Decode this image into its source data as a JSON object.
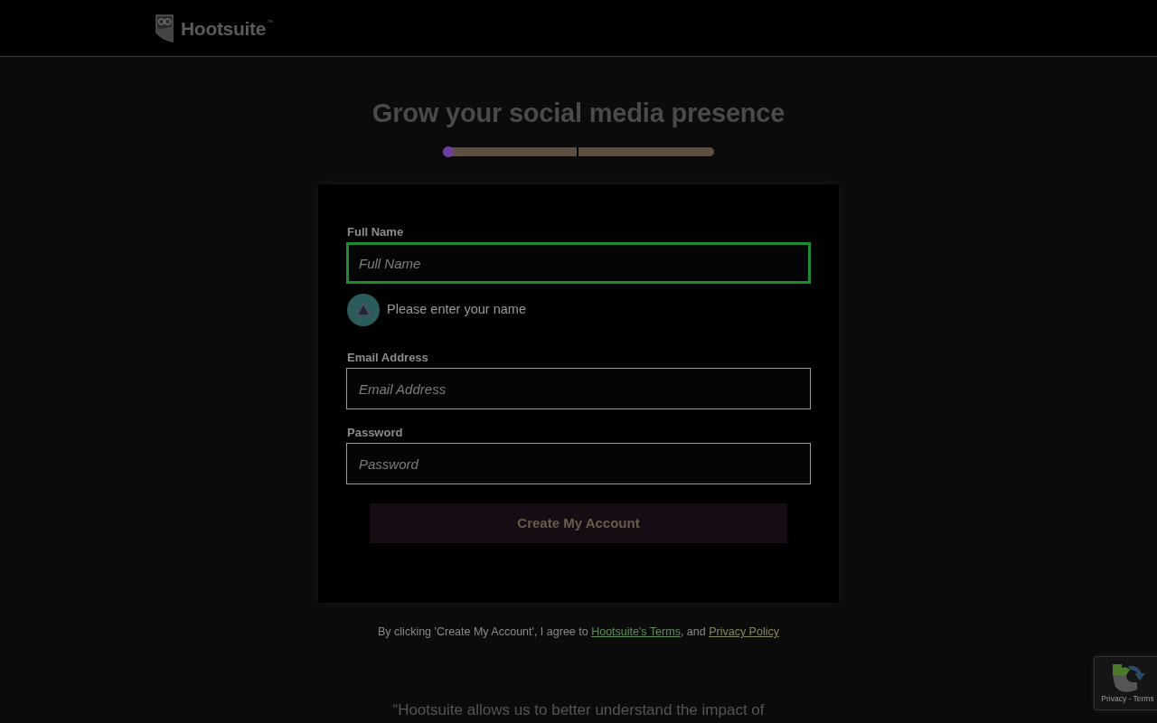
{
  "header": {
    "logo": {
      "wordmark": "Hootsuite",
      "trademark": "™"
    }
  },
  "title": "Grow your social media presence",
  "progress": {
    "level": 0
  },
  "form": {
    "fields": [
      {
        "label": "Full Name",
        "placeholder": "Full Name",
        "focused": true,
        "error": "Please enter your name"
      },
      {
        "label": "Email Address",
        "placeholder": "Email Address",
        "focused": false
      },
      {
        "label": "Password",
        "placeholder": "Password",
        "focused": false
      }
    ],
    "submit_button": "Create My Account"
  },
  "legal": {
    "text": "By clicking 'Create My Account', I agree to",
    "terms_link": "Hootsuite's Terms",
    "separator": ", and",
    "privacy_link": "Privacy Policy"
  },
  "testimonial": "“Hootsuite allows us to better understand the impact of",
  "recaptcha": {
    "links": "Privacy - Terms"
  }
}
